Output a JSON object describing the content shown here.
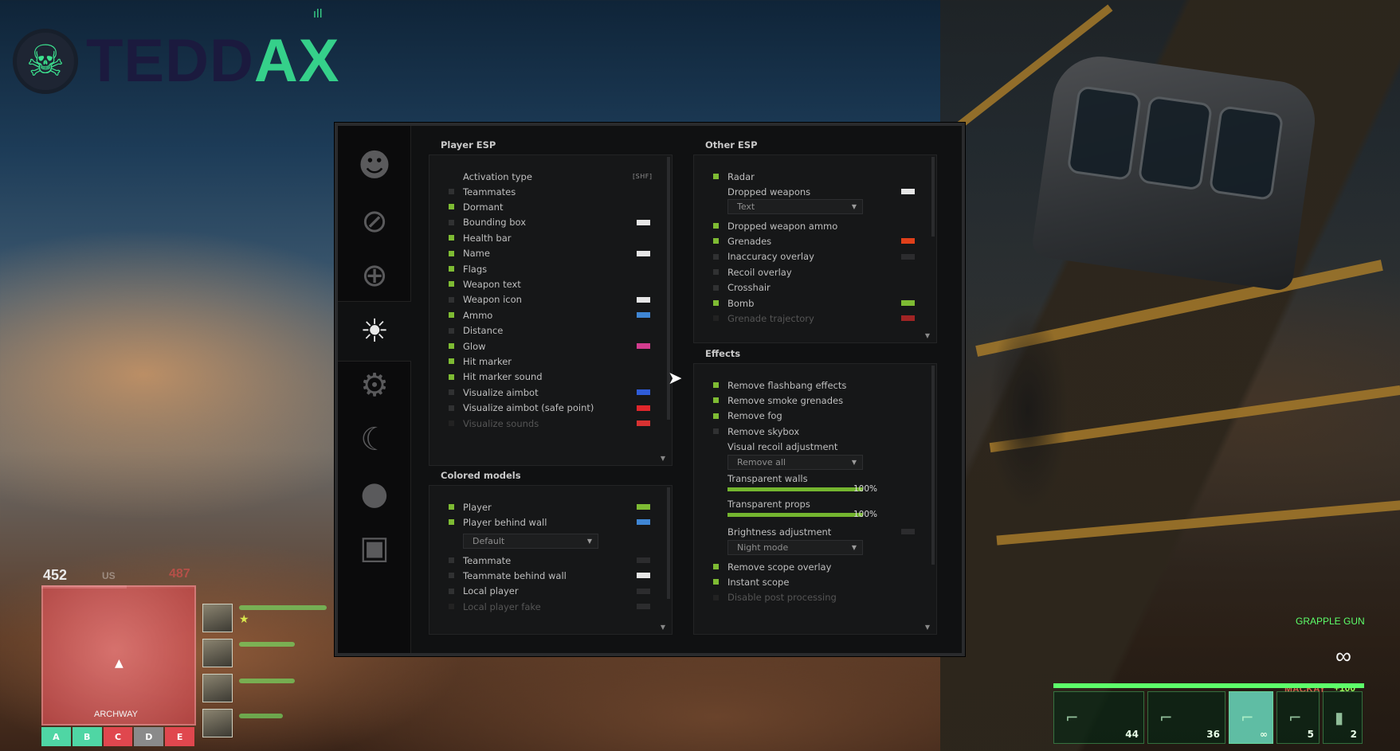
{
  "logo": {
    "skull_glyph": "☠",
    "text_part1": "TEDD",
    "text_part2": "AX",
    "signal_glyph": "ıll"
  },
  "sidebar": {
    "tabs": [
      {
        "name": "ragebot",
        "glyph": "☻"
      },
      {
        "name": "anti-aim",
        "glyph": "⊘"
      },
      {
        "name": "legitbot",
        "glyph": "⊕"
      },
      {
        "name": "visuals",
        "glyph": "☀"
      },
      {
        "name": "misc",
        "glyph": "⚙"
      },
      {
        "name": "skins",
        "glyph": "☾"
      },
      {
        "name": "players",
        "glyph": "●"
      },
      {
        "name": "config",
        "glyph": "▣"
      }
    ]
  },
  "player_esp": {
    "title": "Player ESP",
    "activation": {
      "label": "Activation type",
      "key": "[SHF]"
    },
    "items": [
      {
        "label": "Teammates",
        "on": false
      },
      {
        "label": "Dormant",
        "on": true
      },
      {
        "label": "Bounding box",
        "on": false,
        "color": "#e6e6e6"
      },
      {
        "label": "Health bar",
        "on": true
      },
      {
        "label": "Name",
        "on": true,
        "color": "#e6e6e6"
      },
      {
        "label": "Flags",
        "on": true
      },
      {
        "label": "Weapon text",
        "on": true
      },
      {
        "label": "Weapon icon",
        "on": false,
        "color": "#e6e6e6"
      },
      {
        "label": "Ammo",
        "on": true,
        "color": "#3f86d4"
      },
      {
        "label": "Distance",
        "on": false
      },
      {
        "label": "Glow",
        "on": true,
        "color": "#d23c8e"
      },
      {
        "label": "Hit marker",
        "on": true
      },
      {
        "label": "Hit marker sound",
        "on": true
      },
      {
        "label": "Visualize aimbot",
        "on": false,
        "color": "#2f5cd8"
      },
      {
        "label": "Visualize aimbot (safe point)",
        "on": false,
        "color": "#e0262b"
      },
      {
        "label": "Visualize sounds",
        "on": false,
        "color": "#d83232",
        "dim": true
      }
    ]
  },
  "colored_models": {
    "title": "Colored models",
    "items": [
      {
        "label": "Player",
        "on": true,
        "color": "#7ebb33"
      },
      {
        "label": "Player behind wall",
        "on": true,
        "color": "#3f86d4"
      }
    ],
    "material": "Default",
    "items2": [
      {
        "label": "Teammate",
        "on": false,
        "color": "#2c2c2e"
      },
      {
        "label": "Teammate behind wall",
        "on": false,
        "color": "#e6e6e6"
      },
      {
        "label": "Local player",
        "on": false,
        "color": "#2c2c2e"
      },
      {
        "label": "Local player fake",
        "on": false,
        "color": "#2c2c2e",
        "dim": true
      }
    ]
  },
  "other_esp": {
    "title": "Other ESP",
    "radar": {
      "label": "Radar",
      "on": true
    },
    "dropped_weapons": {
      "label": "Dropped weapons",
      "color": "#e6e6e6"
    },
    "dropped_mode": "Text",
    "items": [
      {
        "label": "Dropped weapon ammo",
        "on": true
      },
      {
        "label": "Grenades",
        "on": true,
        "color": "#e0401a"
      },
      {
        "label": "Inaccuracy overlay",
        "on": false,
        "color": "#2c2c2e"
      },
      {
        "label": "Recoil overlay",
        "on": false
      },
      {
        "label": "Crosshair",
        "on": false
      },
      {
        "label": "Bomb",
        "on": true,
        "color": "#7ebb33"
      },
      {
        "label": "Grenade trajectory",
        "on": false,
        "color": "#a02424",
        "dim": true
      }
    ]
  },
  "effects": {
    "title": "Effects",
    "items": [
      {
        "label": "Remove flashbang effects",
        "on": true
      },
      {
        "label": "Remove smoke grenades",
        "on": true
      },
      {
        "label": "Remove fog",
        "on": true
      },
      {
        "label": "Remove skybox",
        "on": false
      }
    ],
    "recoil_label": "Visual recoil adjustment",
    "recoil_mode": "Remove all",
    "walls": {
      "label": "Transparent walls",
      "value": 100,
      "value_text": "100%"
    },
    "props": {
      "label": "Transparent props",
      "value": 100,
      "value_text": "100%"
    },
    "brightness": {
      "label": "Brightness adjustment",
      "color": "#2c2c2e"
    },
    "brightness_mode": "Night mode",
    "items2": [
      {
        "label": "Remove scope overlay",
        "on": true
      },
      {
        "label": "Instant scope",
        "on": true
      },
      {
        "label": "Disable post processing",
        "on": true,
        "dim": true
      }
    ]
  },
  "hud": {
    "health": "452",
    "health_fraction": 0.55,
    "hp_right": "487",
    "hp_mid": "US",
    "map_label": "ARCHWAY",
    "objectives": [
      {
        "label": "A",
        "color": "#4fd6a4"
      },
      {
        "label": "B",
        "color": "#4fd6a4"
      },
      {
        "label": "C",
        "color": "#e0474e"
      },
      {
        "label": "D",
        "color": "#8a8a8a"
      },
      {
        "label": "E",
        "color": "#e0474e"
      }
    ],
    "squad_star": "★",
    "gadget": "GRAPPLE GUN",
    "infinity": "∞",
    "teammate": "MACKAY",
    "score": "+100",
    "weapons": [
      {
        "count": "44",
        "icon": "⌐",
        "active": false
      },
      {
        "count": "36",
        "icon": "⌐",
        "active": false
      },
      {
        "count": "∞",
        "icon": "⌐",
        "active": true
      },
      {
        "count": "5",
        "icon": "⌐",
        "active": false
      },
      {
        "count": "2",
        "icon": "▮",
        "active": false
      }
    ]
  }
}
